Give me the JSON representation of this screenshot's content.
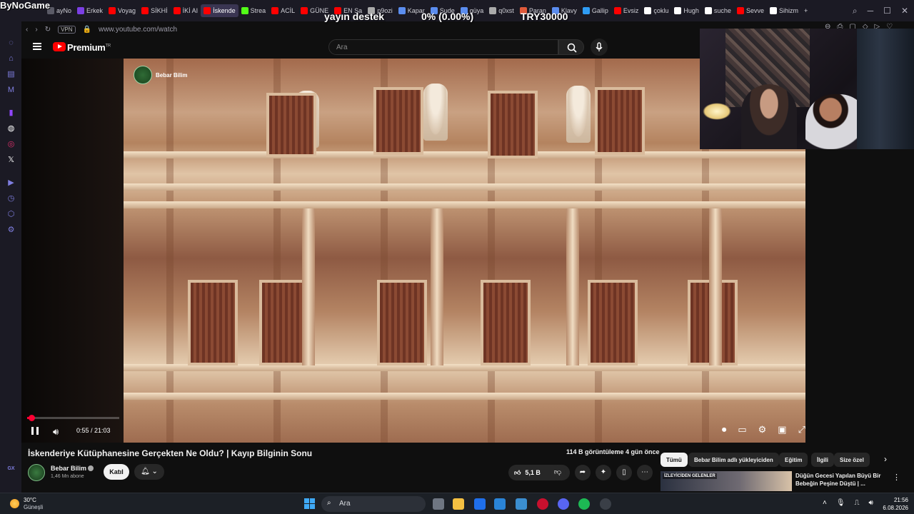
{
  "overlay": {
    "streamer": "ByNoGame",
    "donation_label": "yayın destek",
    "donation_progress": "0% (0.00%)",
    "donation_goal": "TRY30000"
  },
  "browser": {
    "tabs": [
      {
        "label": "ayNo",
        "color": "#5a5a66"
      },
      {
        "label": "Erkek",
        "color": "#7b3fe4"
      },
      {
        "label": "Voyag",
        "color": "#ff0000"
      },
      {
        "label": "SİKHİ",
        "color": "#ff0000"
      },
      {
        "label": "İKİ AI",
        "color": "#ff0000"
      },
      {
        "label": "İskende",
        "color": "#ff0000"
      },
      {
        "label": "Strea",
        "color": "#53fc18"
      },
      {
        "label": "ACİL",
        "color": "#ff0000"
      },
      {
        "label": "GÜNE",
        "color": "#ff0000"
      },
      {
        "label": "EN Sa",
        "color": "#ff0000"
      },
      {
        "label": "p9ozi",
        "color": "#aaaaaa"
      },
      {
        "label": "Kapar",
        "color": "#5b8def"
      },
      {
        "label": "Sude",
        "color": "#5b8def"
      },
      {
        "label": "güya",
        "color": "#5b8def"
      },
      {
        "label": "q0xst",
        "color": "#aaaaaa"
      },
      {
        "label": "Paran",
        "color": "#e05a3a"
      },
      {
        "label": "Klavy",
        "color": "#5b8def"
      },
      {
        "label": "Gallip",
        "color": "#2f9cf4"
      },
      {
        "label": "Evsiz",
        "color": "#ff0000"
      },
      {
        "label": "çoklu",
        "color": "#ffffff"
      },
      {
        "label": "Hugh",
        "color": "#ffffff"
      },
      {
        "label": "suche",
        "color": "#ffffff"
      },
      {
        "label": "Sevve",
        "color": "#ff0000"
      },
      {
        "label": "Sihizm",
        "color": "#ffffff"
      }
    ],
    "active_tab_index": 5,
    "new_tab": "+",
    "vpn": "VPN",
    "url": "www.youtube.com/watch"
  },
  "youtube": {
    "logo_text": "Premium",
    "region": "TR",
    "search_placeholder": "Ara",
    "watermark_channel": "Bebar Bilim",
    "progress_fraction": 0.044,
    "time": "0:55 / 21:03",
    "video_title": "İskenderiye Kütüphanesine Gerçekten Ne Oldu? | Kayıp Bilginin Sonu",
    "views": "114 B görüntüleme  4 gün önce",
    "channel_name": "Bebar Bilim",
    "subscribers": "1,46 Mn abone",
    "join_label": "Katıl",
    "likes": "5,1 B",
    "chips": [
      "Tümü",
      "Bebar Bilim adlı yükleyiciden",
      "Eğitim",
      "İlgili",
      "Size özel"
    ],
    "rec_badge": "İZLEYİCİDEN GELENLER",
    "rec_title": "Düğün Gecesi Yapılan Büyü Bir Bebeğin Peşine Düştü | ..."
  },
  "taskbar": {
    "temperature": "30°C",
    "weather": "Güneşli",
    "search_label": "Ara",
    "time": "21:56",
    "date": "6.08.2026",
    "accent": "#3fa9f5"
  }
}
